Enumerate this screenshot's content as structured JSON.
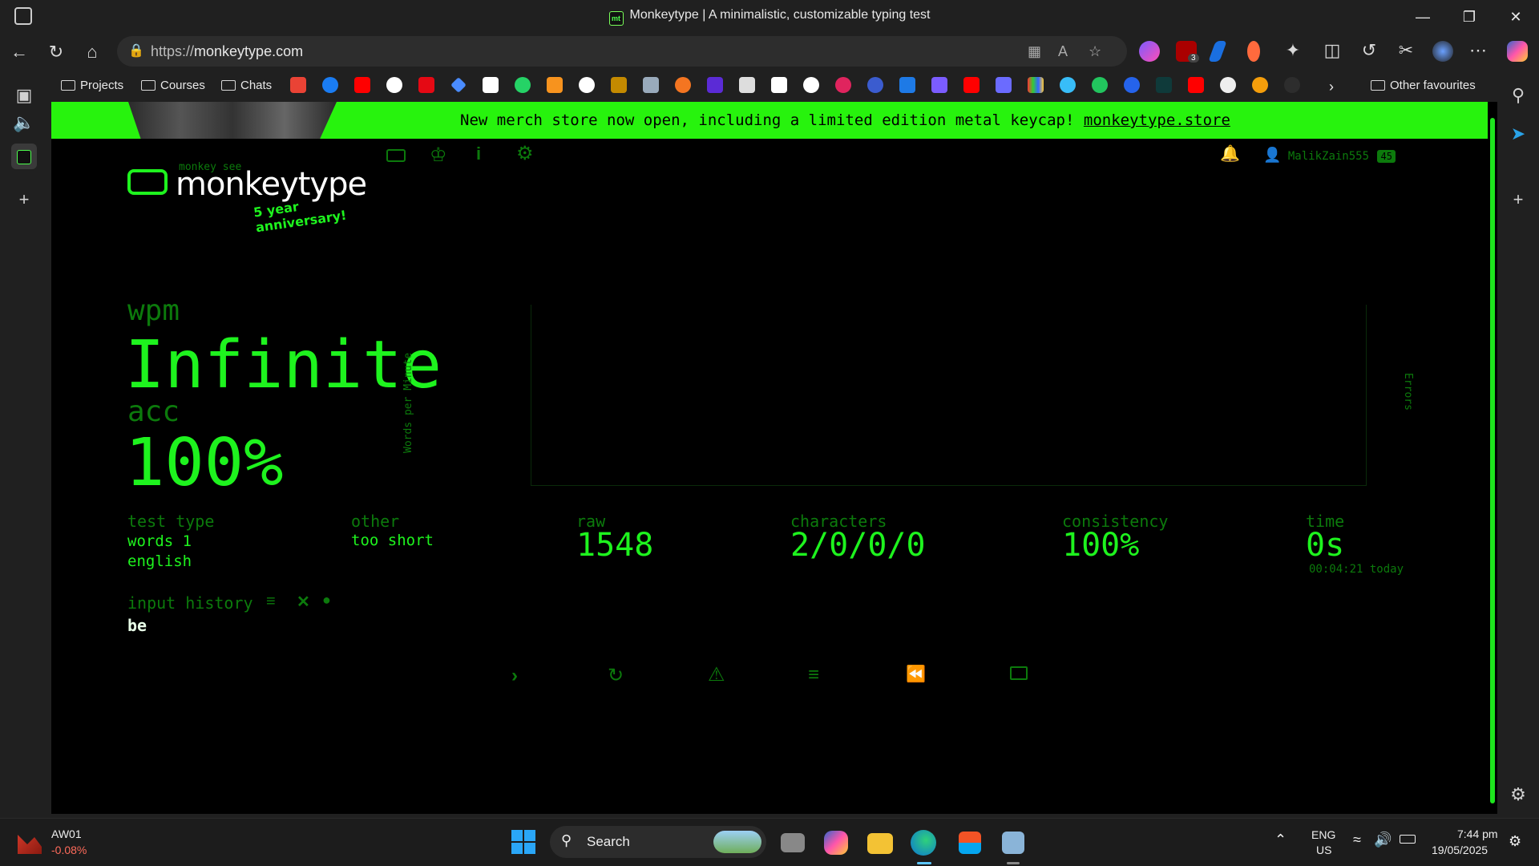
{
  "browser": {
    "tab_title": "Monkeytype | A minimalistic, customizable typing test",
    "favicon_text": "mt",
    "url_prefix": "https://",
    "url_host": "monkeytype.com",
    "bookmarks": [
      "Projects",
      "Courses",
      "Chats"
    ],
    "other_favourites": "Other favourites",
    "ext_badge": "3"
  },
  "banner": {
    "message": "New merch store now open, including a limited edition metal keycap!",
    "link": "monkeytype.store"
  },
  "header": {
    "logo_top": "monkey see",
    "logo_text": "monkeytype",
    "logo_sub": "5 year anniversary!",
    "username": "MalikZain555",
    "level": "45"
  },
  "result": {
    "wpm_label": "wpm",
    "wpm_value": "Infinite",
    "acc_label": "acc",
    "acc_value": "100%",
    "chart_ylabel": "Words per Minute",
    "chart_y2label": "Errors",
    "test_type_label": "test type",
    "test_type_line1": "words 1",
    "test_type_line2": "english",
    "other_label": "other",
    "other_value": "too short",
    "raw_label": "raw",
    "raw_value": "1548",
    "characters_label": "characters",
    "characters_value": "2/0/0/0",
    "consistency_label": "consistency",
    "consistency_value": "100%",
    "time_label": "time",
    "time_value": "0s",
    "time_today": "00:04:21 today",
    "input_history_label": "input history",
    "input_history_value": "be"
  },
  "taskbar": {
    "stock_name": "AW01",
    "stock_change": "-0.08%",
    "search": "Search",
    "lang1": "ENG",
    "lang2": "US",
    "time": "7:44 pm",
    "date": "19/05/2025"
  },
  "colors": {
    "accent": "#1ef31e",
    "dim": "#0c7a0c",
    "banner": "#27f30d",
    "background": "#000000"
  }
}
